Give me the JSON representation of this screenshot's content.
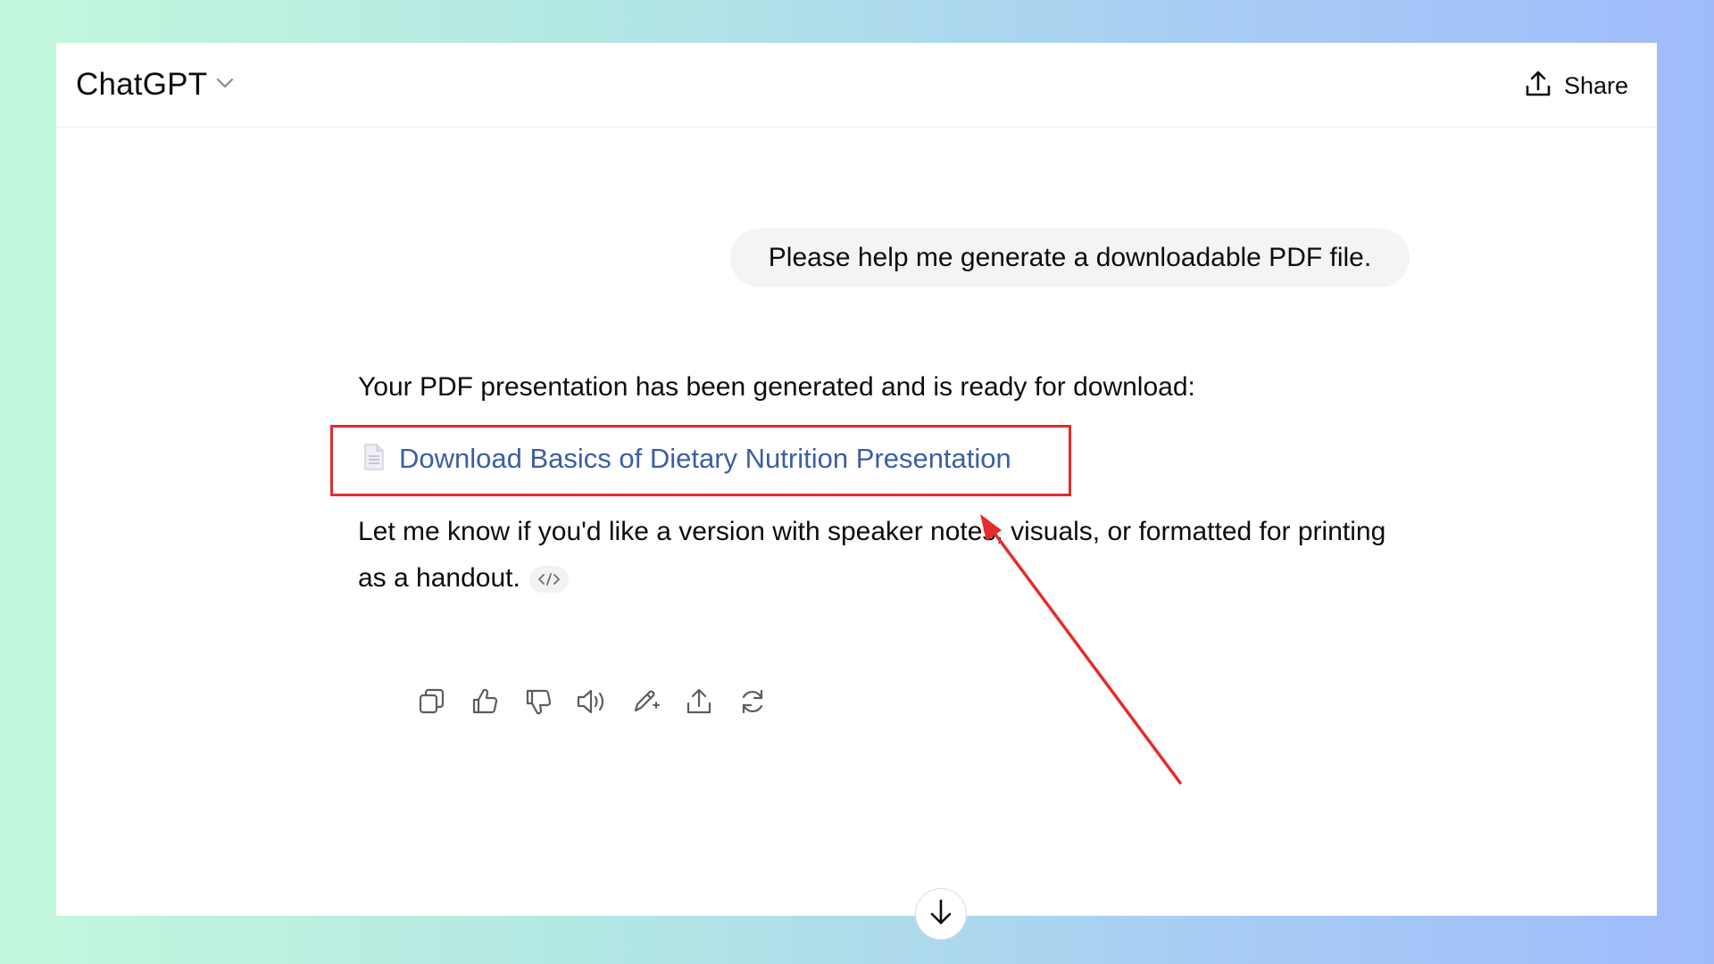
{
  "header": {
    "model_name": "ChatGPT",
    "share_label": "Share"
  },
  "conversation": {
    "user_message": "Please help me generate a downloadable PDF file.",
    "assistant": {
      "intro": "Your PDF presentation has been generated and is ready for download:",
      "download_link_text": "Download Basics of Dietary Nutrition Presentation",
      "followup": "Let me know if you'd like a version with speaker notes, visuals, or formatted for printing as a handout."
    }
  },
  "icons": {
    "model_dropdown": "chevron-down-icon",
    "share": "upload-icon",
    "file": "document-icon",
    "code": "code-icon",
    "actions": [
      "copy-icon",
      "thumbs-up-icon",
      "thumbs-down-icon",
      "speaker-icon",
      "edit-sparkle-icon",
      "share-icon",
      "regenerate-icon"
    ],
    "scroll": "arrow-down-icon"
  },
  "colors": {
    "link": "#3c5da8",
    "annotation": "#e52b2b",
    "bubble": "#f4f4f4"
  }
}
